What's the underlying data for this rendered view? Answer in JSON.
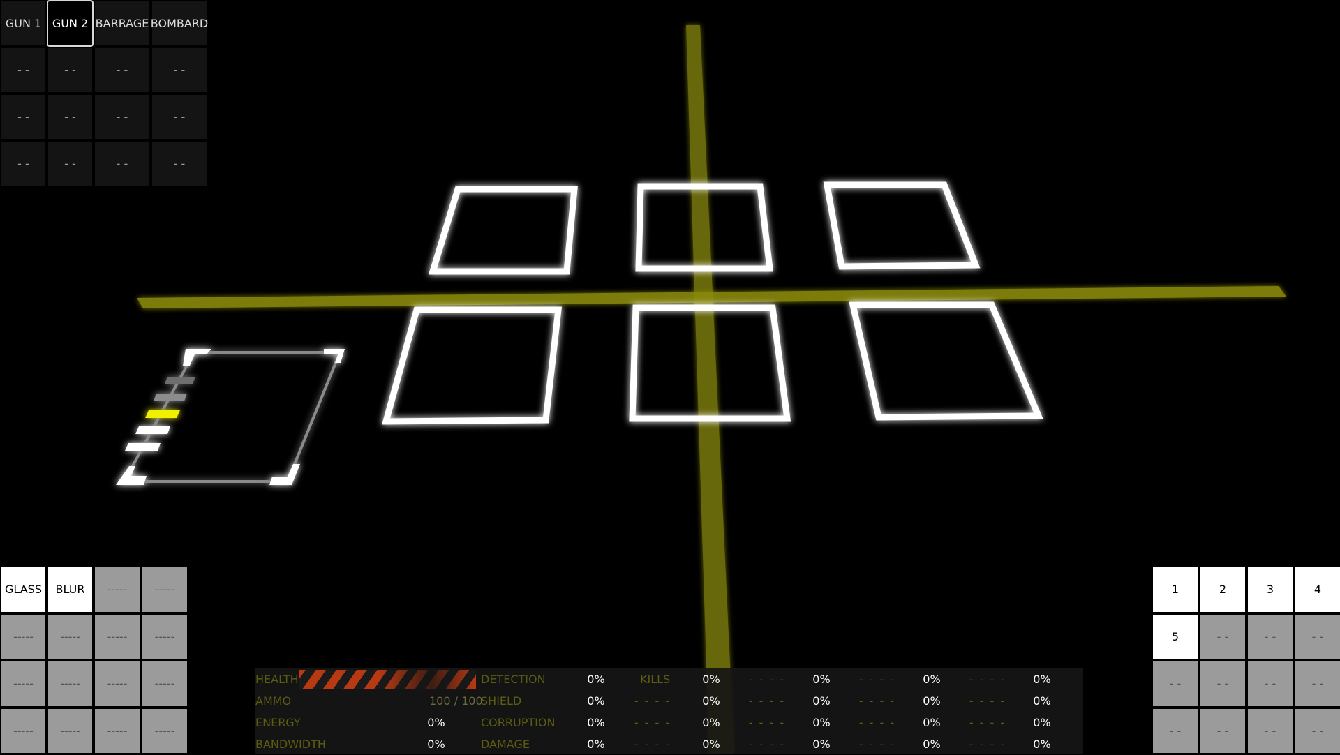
{
  "weapons": {
    "tabs": [
      "GUN 1",
      "GUN 2",
      "BARRAGE",
      "BOMBARD"
    ],
    "active_tab": "GUN 2",
    "rows": [
      [
        "- -",
        "- -",
        "- -",
        "- -"
      ],
      [
        "- -",
        "- -",
        "- -",
        "- -"
      ],
      [
        "- -",
        "- -",
        "- -",
        "- -"
      ]
    ]
  },
  "fx": {
    "cells": [
      [
        "GLASS",
        "BLUR",
        "-----",
        "-----"
      ],
      [
        "-----",
        "-----",
        "-----",
        "-----"
      ],
      [
        "-----",
        "-----",
        "-----",
        "-----"
      ],
      [
        "-----",
        "-----",
        "-----",
        "-----"
      ]
    ],
    "active": [
      "GLASS",
      "BLUR"
    ]
  },
  "slots": {
    "cells": [
      [
        "1",
        "2",
        "3",
        "4"
      ],
      [
        "5",
        "- -",
        "- -",
        "- -"
      ],
      [
        "- -",
        "- -",
        "- -",
        "- -"
      ],
      [
        "- -",
        "- -",
        "- -",
        "- -"
      ]
    ],
    "active": [
      "1",
      "2",
      "3",
      "4",
      "5"
    ]
  },
  "stats": {
    "health_label": "HEALTH",
    "ammo_label": "AMMO",
    "ammo_value": "100 / 100",
    "energy_label": "ENERGY",
    "energy_value": "0%",
    "bandwidth_label": "BANDWIDTH",
    "bandwidth_value": "0%",
    "matrix": [
      [
        "DETECTION",
        "0%",
        "KILLS",
        "0%",
        "- - - -",
        "0%",
        "- - - -",
        "0%",
        "- - - -",
        "0%"
      ],
      [
        "SHIELD",
        "0%",
        "- - - -",
        "0%",
        "- - - -",
        "0%",
        "- - - -",
        "0%",
        "- - - -",
        "0%"
      ],
      [
        "CORRUPTION",
        "0%",
        "- - - -",
        "0%",
        "- - - -",
        "0%",
        "- - - -",
        "0%",
        "- - - -",
        "0%"
      ],
      [
        "DAMAGE",
        "0%",
        "- - - -",
        "0%",
        "- - - -",
        "0%",
        "- - - -",
        "0%",
        "- - - -",
        "0%"
      ]
    ]
  },
  "colors": {
    "accent_yellow": "#b5b514",
    "health_stripe": "#b83a12",
    "label_olive": "#5b5d10"
  }
}
